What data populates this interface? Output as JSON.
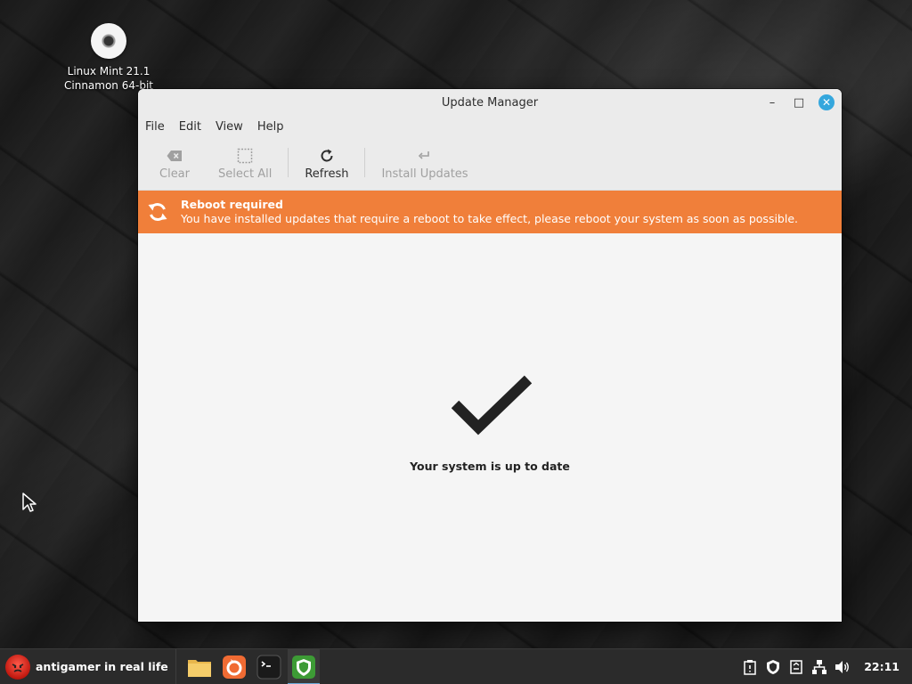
{
  "desktop": {
    "icon_label_line1": "Linux Mint 21.1",
    "icon_label_line2": "Cinnamon 64-bit"
  },
  "window": {
    "title": "Update Manager",
    "controls": {
      "minimize": "–",
      "maximize": "□",
      "close": "✕"
    }
  },
  "menu": {
    "file": "File",
    "edit": "Edit",
    "view": "View",
    "help": "Help"
  },
  "toolbar": {
    "clear": "Clear",
    "select_all": "Select All",
    "refresh": "Refresh",
    "install_updates": "Install Updates"
  },
  "banner": {
    "title": "Reboot required",
    "message": "You have installed updates that require a reboot to take effect, please reboot your system as soon as possible.",
    "color": "#f07f3a"
  },
  "status": {
    "text": "Your system is up to date"
  },
  "taskbar": {
    "menu_label": "antigamer in real life",
    "clock": "22:11",
    "pinned": [
      "files-icon",
      "firefox-icon",
      "terminal-icon",
      "update-manager-icon"
    ],
    "tray": [
      "clipboard-icon",
      "shield-icon",
      "notes-icon",
      "network-icon",
      "volume-icon"
    ]
  }
}
